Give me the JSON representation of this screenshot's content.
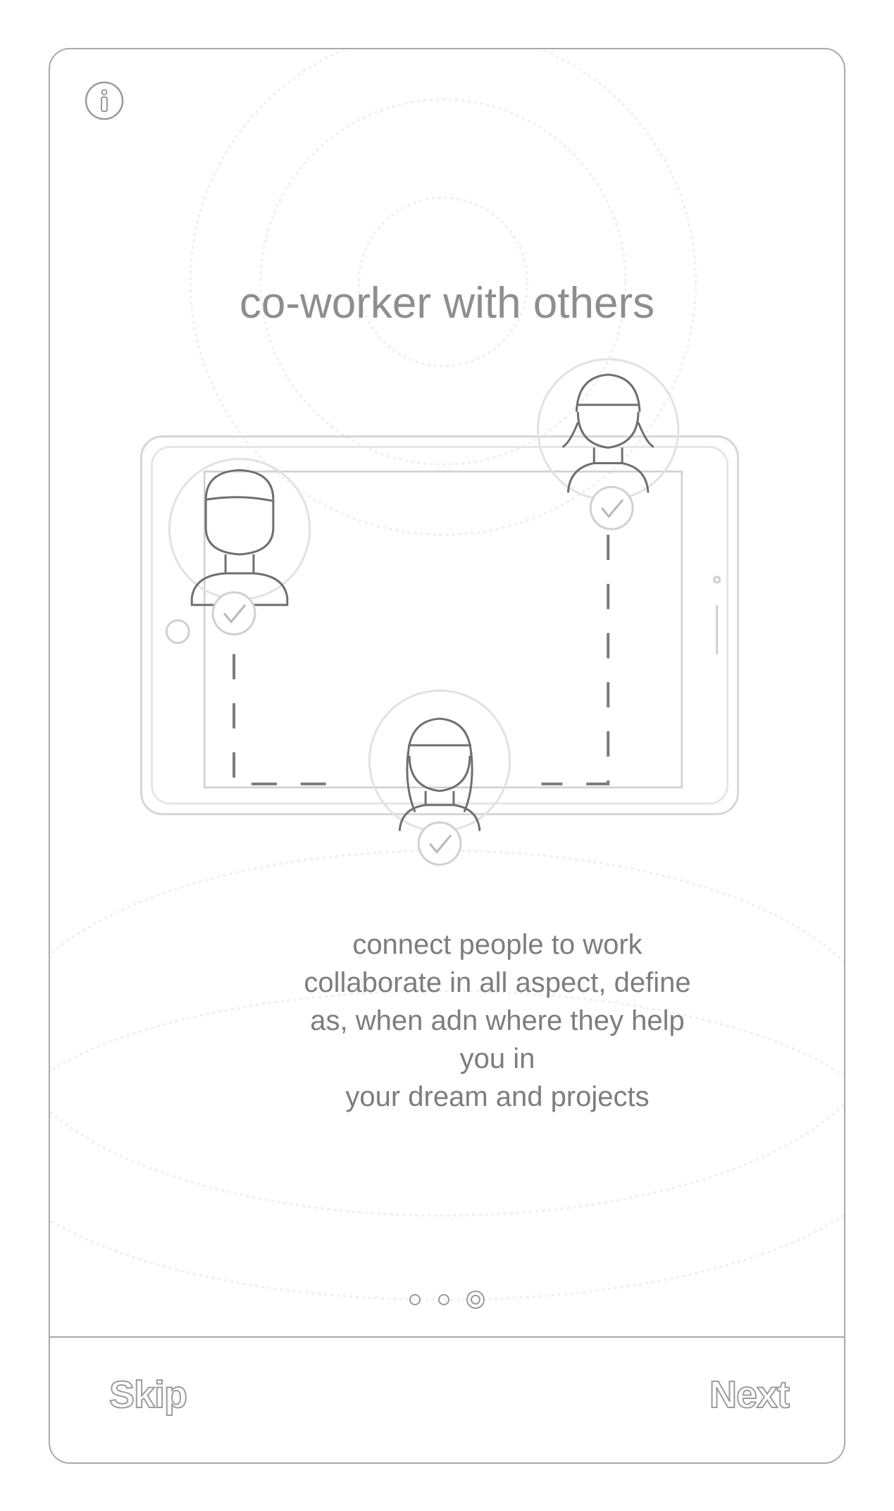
{
  "header": {
    "info_icon": "info-icon"
  },
  "title": "co-worker with others",
  "description": "connect people to work\ncollaborate in all aspect, define\n as, when adn where they help\nyou in\nyour dream and projects",
  "pagination": {
    "total": 3,
    "current": 3
  },
  "footer": {
    "skip_label": "Skip",
    "next_label": "Next"
  },
  "colors": {
    "line": "#a9a9a9",
    "text": "#7d7d7d"
  }
}
